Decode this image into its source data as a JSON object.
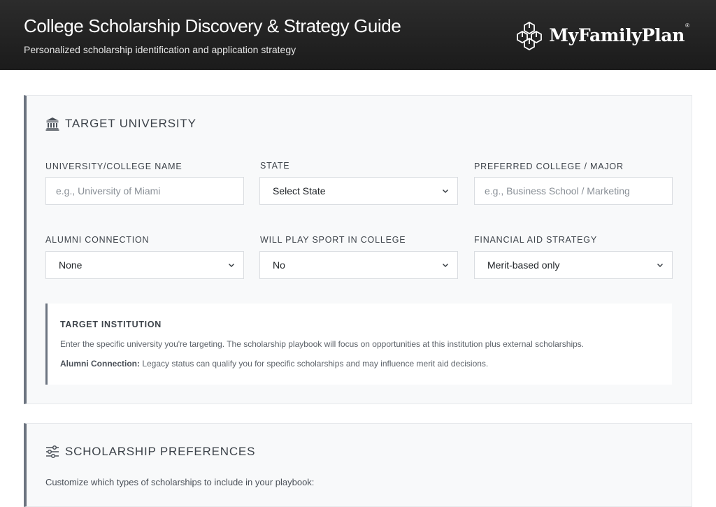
{
  "header": {
    "title": "College Scholarship Discovery & Strategy Guide",
    "subtitle": "Personalized scholarship identification and application strategy",
    "brand": "MyFamilyPlan",
    "brand_mark": "®"
  },
  "target_university": {
    "section_title": "TARGET UNIVERSITY",
    "section_icon": "bank-icon",
    "fields": {
      "university_name": {
        "label": "UNIVERSITY/COLLEGE NAME",
        "placeholder": "e.g., University of Miami",
        "value": ""
      },
      "state": {
        "label": "STATE",
        "selected": "Select State"
      },
      "preferred_major": {
        "label": "PREFERRED COLLEGE / MAJOR",
        "placeholder": "e.g., Business School / Marketing",
        "value": ""
      },
      "alumni_connection": {
        "label": "ALUMNI CONNECTION",
        "selected": "None"
      },
      "sport": {
        "label": "WILL PLAY SPORT IN COLLEGE",
        "selected": "No"
      },
      "aid_strategy": {
        "label": "FINANCIAL AID STRATEGY",
        "selected": "Merit-based only"
      }
    },
    "info": {
      "title": "TARGET INSTITUTION",
      "line1": "Enter the specific university you're targeting. The scholarship playbook will focus on opportunities at this institution plus external scholarships.",
      "line2_label": "Alumni Connection:",
      "line2_text": " Legacy status can qualify you for specific scholarships and may influence merit aid decisions."
    }
  },
  "scholarship_preferences": {
    "section_title": "SCHOLARSHIP PREFERENCES",
    "section_icon": "sliders-icon",
    "description": "Customize which types of scholarships to include in your playbook:"
  },
  "colors": {
    "header_bg": "#1f1f1f",
    "card_bg": "#f8f9fa",
    "accent_border": "#6c7480"
  }
}
